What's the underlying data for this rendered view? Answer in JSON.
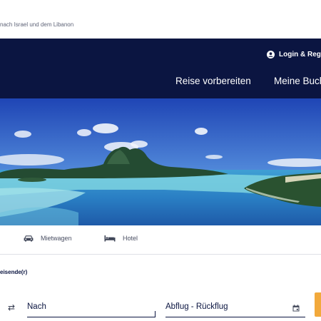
{
  "notice": {
    "text": "nach Israel und dem Libanon"
  },
  "header": {
    "login_label": "Login & Reg",
    "nav": [
      {
        "label": "Reise vorbereiten"
      },
      {
        "label": "Meine Buch"
      }
    ]
  },
  "tabs": [
    {
      "label": "Mietwagen",
      "icon": "car-icon"
    },
    {
      "label": "Hotel",
      "icon": "bed-icon"
    }
  ],
  "form": {
    "passengers_label": "eisende(r)",
    "to_placeholder": "Nach",
    "dates_placeholder": "Abflug - Rückflug"
  },
  "colors": {
    "header_bg": "#0b1541",
    "accent": "#f2a93b"
  }
}
